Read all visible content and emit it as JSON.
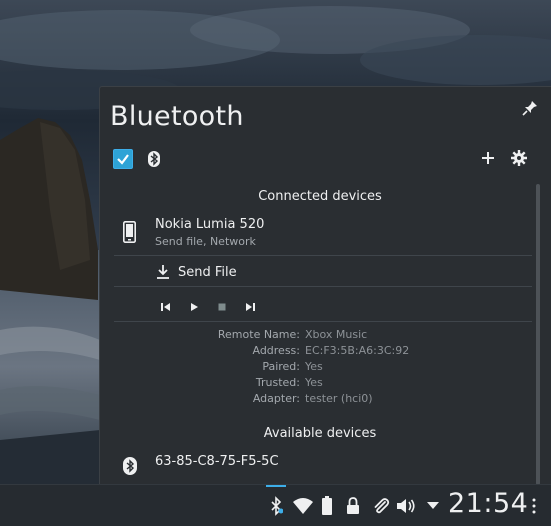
{
  "popup": {
    "title": "Bluetooth",
    "enabled": true,
    "icons": {
      "pin": "pin-icon",
      "bluetooth": "bluetooth-icon",
      "add": "add-icon",
      "settings": "gear-icon"
    }
  },
  "connected": {
    "header": "Connected devices",
    "device": {
      "name": "Nokia Lumia 520",
      "info": "Send file, Network",
      "icon": "phone-icon"
    },
    "send_file_label": "Send File",
    "media_controls": [
      "previous-icon",
      "play-icon",
      "stop-icon",
      "next-icon"
    ],
    "properties": [
      {
        "key": "Remote Name:",
        "value": "Xbox Music"
      },
      {
        "key": "Address:",
        "value": "EC:F3:5B:A6:3C:92"
      },
      {
        "key": "Paired:",
        "value": "Yes"
      },
      {
        "key": "Trusted:",
        "value": "Yes"
      },
      {
        "key": "Adapter:",
        "value": "tester (hci0)"
      }
    ]
  },
  "available": {
    "header": "Available devices",
    "devices": [
      {
        "name": "63-85-C8-75-F5-5C",
        "icon": "bluetooth-icon"
      }
    ]
  },
  "panel": {
    "clock": "21:54",
    "accent": "#3daee9",
    "tray_icons": [
      "bluetooth-icon",
      "wifi-icon",
      "battery-icon",
      "lock-icon",
      "paperclip-icon",
      "volume-icon",
      "expand-arrow-icon"
    ]
  }
}
